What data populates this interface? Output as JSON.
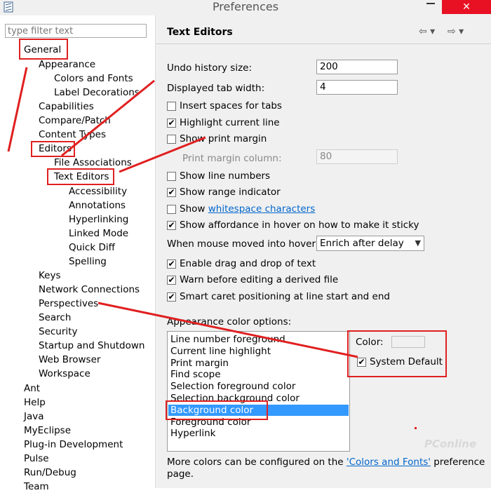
{
  "window": {
    "title": "Preferences",
    "close_glyph": "✕",
    "app_icon": "eclipse-icon"
  },
  "filter": {
    "placeholder": "type filter text"
  },
  "tree": [
    {
      "label": "General"
    },
    {
      "label": "Appearance"
    },
    {
      "label": "Colors and Fonts"
    },
    {
      "label": "Label Decorations"
    },
    {
      "label": "Capabilities"
    },
    {
      "label": "Compare/Patch"
    },
    {
      "label": "Content Types"
    },
    {
      "label": "Editors"
    },
    {
      "label": "File Associations"
    },
    {
      "label": "Text Editors"
    },
    {
      "label": "Accessibility"
    },
    {
      "label": "Annotations"
    },
    {
      "label": "Hyperlinking"
    },
    {
      "label": "Linked Mode"
    },
    {
      "label": "Quick Diff"
    },
    {
      "label": "Spelling"
    },
    {
      "label": "Keys"
    },
    {
      "label": "Network Connections"
    },
    {
      "label": "Perspectives"
    },
    {
      "label": "Search"
    },
    {
      "label": "Security"
    },
    {
      "label": "Startup and Shutdown"
    },
    {
      "label": "Web Browser"
    },
    {
      "label": "Workspace"
    },
    {
      "label": "Ant"
    },
    {
      "label": "Help"
    },
    {
      "label": "Java"
    },
    {
      "label": "MyEclipse"
    },
    {
      "label": "Plug-in Development"
    },
    {
      "label": "Pulse"
    },
    {
      "label": "Run/Debug"
    },
    {
      "label": "Team"
    }
  ],
  "page": {
    "title": "Text Editors",
    "back_glyph": "⇦ ▾",
    "forward_glyph": "⇨ ▾",
    "undo_label": "Undo history size:",
    "undo_value": "200",
    "tab_label": "Displayed tab width:",
    "tab_value": "4",
    "insert_spaces": "Insert spaces for tabs",
    "highlight_line": "Highlight current line",
    "show_margin": "Show print margin",
    "margin_column_label": "Print margin column:",
    "margin_column_value": "80",
    "line_numbers": "Show line numbers",
    "range_indicator": "Show range indicator",
    "show_prefix": "Show",
    "whitespace_link": "whitespace characters",
    "affordance": "Show affordance in hover on how to make it sticky",
    "hover_label": "When mouse moved into hover:",
    "hover_value": "Enrich after delay",
    "drag_drop": "Enable drag and drop of text",
    "warn_derived": "Warn before editing a derived file",
    "smart_caret": "Smart caret positioning at line start and end",
    "appearance_label": "Appearance color options:",
    "color_options": [
      "Line number foreground",
      "Current line highlight",
      "Print margin",
      "Find scope",
      "Selection foreground color",
      "Selection background color",
      "Background color",
      "Foreground color",
      "Hyperlink"
    ],
    "selected_option": "Background color",
    "color_label": "Color:",
    "system_default": "System Default",
    "footer_pre": "More colors can be configured on the",
    "footer_link": "'Colors and Fonts'",
    "footer_post": "preference",
    "footer_line2": "page.",
    "check_glyph": "✔"
  },
  "checkbox_states": {
    "insert_spaces": false,
    "highlight_line": true,
    "show_margin": false,
    "line_numbers": false,
    "range_indicator": true,
    "whitespace": false,
    "affordance": true,
    "drag_drop": true,
    "warn_derived": true,
    "smart_caret": true,
    "system_default": true
  },
  "watermark": "PConline",
  "colors": {
    "annotation": "#e02020",
    "selection": "#3399ff",
    "link": "#0066cc"
  }
}
